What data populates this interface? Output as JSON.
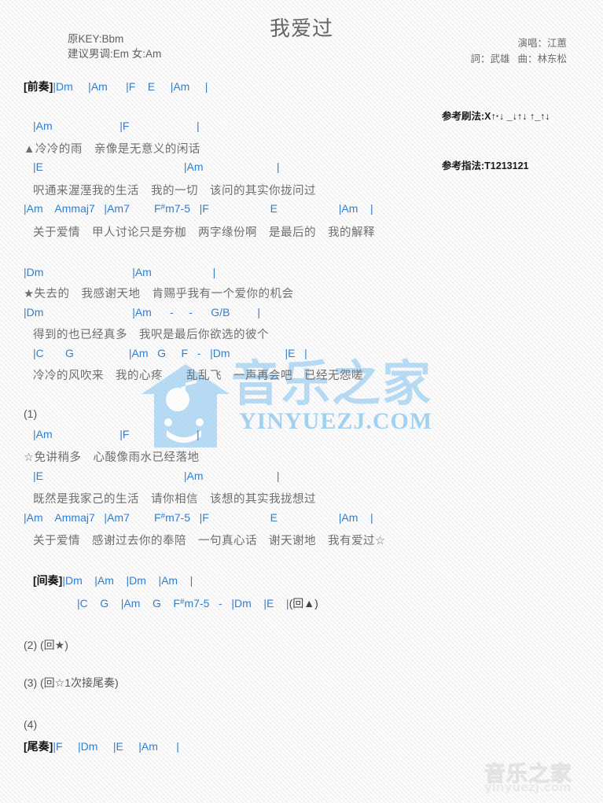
{
  "header": {
    "title": "我爱过",
    "original_key": "原KEY:Bbm",
    "suggested_key": "建议男调:Em 女:Am",
    "singer_label": "演唱：江蕙",
    "lyricist_label": "詞：武雄",
    "composer_label": "曲：林东松",
    "strum_label": "参考刷法:",
    "strum_value": "X↑·↓ _↓↑↓ ↑_↑↓",
    "finger_label": "参考指法:",
    "finger_value": "T1213121"
  },
  "sections": {
    "prelude_tag": "[前奏]",
    "interlude_tag": "[间奏]",
    "outro_tag": "[尾奏]",
    "num1": "(1)",
    "num2": "(2)",
    "num3": "(3)",
    "num4": "(4)",
    "repeat_star_solid": "(回★)",
    "repeat_star_hollow": "(回☆1次接尾奏)",
    "repeat_triangle": "(回▲)"
  },
  "lines": {
    "prelude_chords": "|Dm     |Am      |F    E     |Am     |",
    "v1_c1": "|Am                      |F                      |",
    "v1_l1": "▲冷冷的雨　亲像是无意义的闲话",
    "v1_c2": "|E                                              |Am                        |",
    "v1_l2": "呎通来渥溼我的生活　我的一切　该问的其实你拢问过",
    "v1_c3_a": "|Am    Ammaj7   |Am7        F",
    "v1_c3_sharp": "#",
    "v1_c3_b": "m7-5   |F                    E                    |Am    |",
    "v1_l3": "关于爱情　甲人讨论只是夯枷　两字缘份啊　是最后的　我的解释",
    "ch_c1": "|Dm                             |Am                    |",
    "ch_l1": "★失去的　我感谢天地　肯赐乎我有一个爱你的机会",
    "ch_c2": "|Dm                             |Am      -     -      G/B         |",
    "ch_l2": "得到的也已经真多　我呎是最后你欲选的彼个",
    "ch_c3": "|C       G                  |Am   G     F   -   |Dm                  |E   |",
    "ch_l3": "冷冷的风吹来　我的心疼　　乱乱飞　一声再会吧　已经无怨嗟",
    "v2_c1": "|Am                      |F                      |",
    "v2_l1": "☆免讲稍多　心酸像雨水已经落地",
    "v2_c2": "|E                                              |Am                        |",
    "v2_l2": "既然是我家己的生活　请你相信　该想的其实我拢想过",
    "v2_c3_a": "|Am    Ammaj7   |Am7        F",
    "v2_c3_sharp": "#",
    "v2_c3_b": "m7-5   |F                    E                    |Am    |",
    "v2_l3": "关于爱情　感谢过去你的奉陪　一句真心话　谢天谢地　我有爱过☆",
    "interlude_1": "|Dm    |Am    |Dm    |Am    |",
    "interlude_2_a": "|C    G    |Am    G    F",
    "interlude_2_sharp": "#",
    "interlude_2_b": "m7-5   -   |Dm    |E    |",
    "outro_chords": "|F     |Dm     |E     |Am      |"
  },
  "watermark": {
    "main_text": "音乐之家",
    "main_url": "YINYUEZJ.COM",
    "bottom_text": "音乐之家",
    "bottom_url": "yinyuezj.com"
  },
  "colors": {
    "chord_blue": "#2e7fd0",
    "bar_blue": "#1b4f8f",
    "lyric_gray": "#6e6e6e",
    "watermark_blue": "#8ec8f0"
  }
}
